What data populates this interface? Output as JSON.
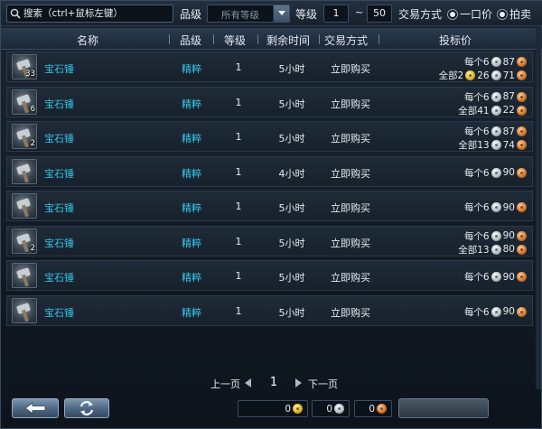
{
  "filter": {
    "search_placeholder": "搜索（ctrl+鼠标左键）",
    "grade_label": "品级",
    "grade_value": "所有等级",
    "level_label": "等级",
    "level_min": "1",
    "level_sep": "~",
    "level_max": "50",
    "trade_label": "交易方式",
    "option_fixed": "一口价",
    "option_auction": "拍卖",
    "option_fixed_selected": true,
    "option_auction_selected": true
  },
  "columns": {
    "name": "名称",
    "grade": "品级",
    "level": "等级",
    "time": "剩余时间",
    "trade": "交易方式",
    "price": "投标价"
  },
  "rows": [
    {
      "name": "宝石锤",
      "qty": "33",
      "grade": "精粹",
      "level": "1",
      "time": "5小时",
      "trade": "立即购买",
      "price1": {
        "label": "每个6",
        "silver": "87"
      },
      "price2": {
        "label": "全部2",
        "gold": "26",
        "silver": "71"
      }
    },
    {
      "name": "宝石锤",
      "qty": "6",
      "grade": "精粹",
      "level": "1",
      "time": "5小时",
      "trade": "立即购买",
      "price1": {
        "label": "每个6",
        "silver": "87"
      },
      "price2": {
        "label": "全部41",
        "silver": "22"
      }
    },
    {
      "name": "宝石锤",
      "qty": "2",
      "grade": "精粹",
      "level": "1",
      "time": "5小时",
      "trade": "立即购买",
      "price1": {
        "label": "每个6",
        "silver": "87"
      },
      "price2": {
        "label": "全部13",
        "silver": "74"
      }
    },
    {
      "name": "宝石锤",
      "qty": "",
      "grade": "精粹",
      "level": "1",
      "time": "4小时",
      "trade": "立即购买",
      "price1": {
        "label": "每个6",
        "silver": "90"
      },
      "price2": null
    },
    {
      "name": "宝石锤",
      "qty": "",
      "grade": "精粹",
      "level": "1",
      "time": "5小时",
      "trade": "立即购买",
      "price1": {
        "label": "每个6",
        "silver": "90"
      },
      "price2": null
    },
    {
      "name": "宝石锤",
      "qty": "2",
      "grade": "精粹",
      "level": "1",
      "time": "5小时",
      "trade": "立即购买",
      "price1": {
        "label": "每个6",
        "silver": "90"
      },
      "price2": {
        "label": "全部13",
        "silver": "80"
      }
    },
    {
      "name": "宝石锤",
      "qty": "",
      "grade": "精粹",
      "level": "1",
      "time": "5小时",
      "trade": "立即购买",
      "price1": {
        "label": "每个6",
        "silver": "90"
      },
      "price2": null
    },
    {
      "name": "宝石锤",
      "qty": "",
      "grade": "精粹",
      "level": "1",
      "time": "5小时",
      "trade": "立即购买",
      "price1": {
        "label": "每个6",
        "silver": "90"
      },
      "price2": null
    }
  ],
  "pager": {
    "prev": "上一页",
    "page": "1",
    "next": "下一页"
  },
  "bottom": {
    "gold_amount": "0",
    "silver_amount": "0",
    "copper_amount": "0"
  },
  "colors": {
    "accent_text": "#33c3e8",
    "gold_coin": "#e2b322",
    "silver_coin": "#b9c2c8",
    "copper_coin": "#d6792c"
  }
}
